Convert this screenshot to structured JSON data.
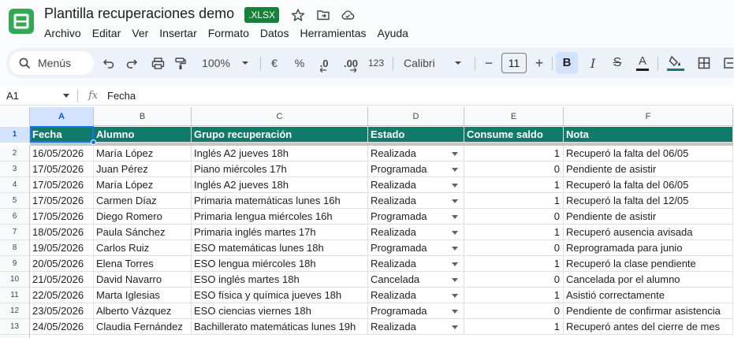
{
  "app": {
    "doc_title": "Plantilla recuperaciones demo",
    "file_badge": "XLSX",
    "header_icons": [
      "star-icon",
      "move-to-folder-icon",
      "cloud-saved-icon"
    ]
  },
  "menu": [
    "Archivo",
    "Editar",
    "Ver",
    "Insertar",
    "Formato",
    "Datos",
    "Herramientas",
    "Ayuda"
  ],
  "toolbar": {
    "search_label": "Menús",
    "zoom": "100%",
    "currency": "€",
    "percent": "%",
    "decrease_decimals": ".0",
    "increase_decimals": ".00",
    "number_format": "123",
    "font": "Calibri",
    "font_size": "11",
    "minus": "−",
    "plus": "+",
    "bold": "B",
    "italic": "I",
    "strike": "S",
    "text_color": "A"
  },
  "formula_bar": {
    "cell_ref": "A1",
    "fx": "fx",
    "value": "Fecha"
  },
  "sheet": {
    "column_letters": [
      "A",
      "B",
      "C",
      "D",
      "E",
      "F"
    ],
    "headers": [
      "Fecha",
      "Alumno",
      "Grupo recuperación",
      "Estado",
      "Consume saldo",
      "Nota"
    ],
    "rows": [
      [
        "16/05/2026",
        "María López",
        "Inglés A2 jueves 18h",
        "Realizada",
        "1",
        "Recuperó la falta del 06/05"
      ],
      [
        "17/05/2026",
        "Juan Pérez",
        "Piano miércoles 17h",
        "Programada",
        "0",
        "Pendiente de asistir"
      ],
      [
        "17/05/2026",
        "María López",
        "Inglés A2 jueves 18h",
        "Realizada",
        "1",
        "Recuperó la falta del 06/05"
      ],
      [
        "17/05/2026",
        "Carmen Díaz",
        "Primaria matemáticas lunes 16h",
        "Realizada",
        "1",
        "Recuperó la falta del 12/05"
      ],
      [
        "17/05/2026",
        "Diego Romero",
        "Primaria lengua miércoles 16h",
        "Programada",
        "0",
        "Pendiente de asistir"
      ],
      [
        "18/05/2026",
        "Paula Sánchez",
        "Primaria inglés martes 17h",
        "Realizada",
        "1",
        "Recuperó ausencia avisada"
      ],
      [
        "19/05/2026",
        "Carlos Ruiz",
        "ESO matemáticas lunes 18h",
        "Programada",
        "0",
        "Reprogramada para junio"
      ],
      [
        "20/05/2026",
        "Elena Torres",
        "ESO lengua miércoles 18h",
        "Realizada",
        "1",
        "Recuperó la clase pendiente"
      ],
      [
        "21/05/2026",
        "David Navarro",
        "ESO inglés martes 18h",
        "Cancelada",
        "0",
        "Cancelada por el alumno"
      ],
      [
        "22/05/2026",
        "Marta Iglesias",
        "ESO física y química jueves 18h",
        "Realizada",
        "1",
        "Asistió correctamente"
      ],
      [
        "23/05/2026",
        "Alberto Vázquez",
        "ESO ciencias viernes 18h",
        "Programada",
        "0",
        "Pendiente de confirmar asistencia"
      ],
      [
        "24/05/2026",
        "Claudia Fernández",
        "Bachillerato matemáticas lunes 19h",
        "Realizada",
        "1",
        "Recuperó antes del cierre de mes"
      ]
    ]
  },
  "colors": {
    "header_fill": "#127a6a",
    "selection": "#1a73e8",
    "brand_green": "#188038"
  }
}
